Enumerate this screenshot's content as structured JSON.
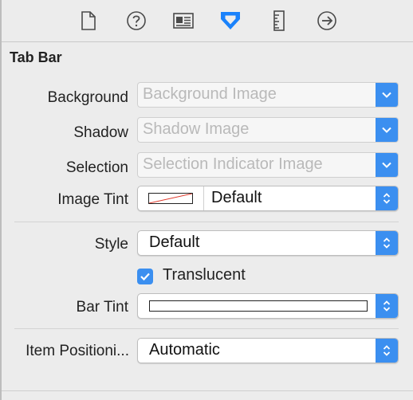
{
  "section": {
    "title": "Tab Bar"
  },
  "toolbar": {
    "icons": [
      "file-inspector-icon",
      "quick-help-icon",
      "identity-inspector-icon",
      "attributes-inspector-icon",
      "size-inspector-icon",
      "connections-inspector-icon"
    ],
    "selected_color": "#1a82fb",
    "icon_color": "#4a4a4a"
  },
  "fields": {
    "background": {
      "label": "Background",
      "placeholder": "Background Image"
    },
    "shadow": {
      "label": "Shadow",
      "placeholder": "Shadow Image"
    },
    "selection": {
      "label": "Selection",
      "placeholder": "Selection Indicator Image"
    },
    "image_tint": {
      "label": "Image Tint",
      "value": "Default"
    },
    "style": {
      "label": "Style",
      "value": "Default"
    },
    "translucent": {
      "label": "Translucent",
      "checked": true
    },
    "bar_tint": {
      "label": "Bar Tint"
    },
    "item_positioning": {
      "label": "Item Positioni...",
      "value": "Automatic"
    }
  },
  "colors": {
    "accent": "#3b8ff0",
    "panel": "#ececec"
  }
}
